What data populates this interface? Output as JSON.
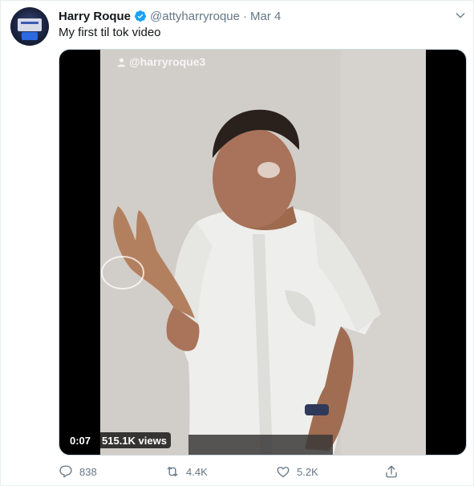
{
  "tweet": {
    "author_name": "Harry Roque",
    "handle": "@attyharryroque",
    "separator": "·",
    "date": "Mar 4",
    "text": "My first til tok video"
  },
  "media": {
    "watermark": "@harryroque3",
    "time": "0:07",
    "views": "515.1K views"
  },
  "actions": {
    "replies": "838",
    "retweets": "4.4K",
    "likes": "5.2K"
  },
  "icons": {
    "verified": "verified-badge-icon",
    "menu": "chevron-down-icon",
    "reply": "reply-icon",
    "retweet": "retweet-icon",
    "like": "heart-icon",
    "share": "share-icon"
  },
  "colors": {
    "accent": "#1da1f2",
    "secondary_text": "#657786"
  }
}
